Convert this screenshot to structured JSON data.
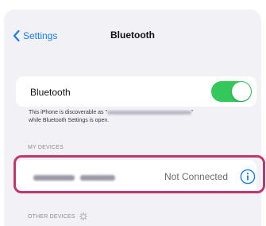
{
  "nav": {
    "back_label": "Settings",
    "title": "Bluetooth"
  },
  "bluetooth": {
    "label": "Bluetooth",
    "enabled": true,
    "desc_prefix": "This iPhone is discoverable as \"",
    "desc_suffix": "\"",
    "desc_line2": "while Bluetooth Settings is open."
  },
  "sections": {
    "my_devices": "MY DEVICES",
    "other_devices": "OTHER DEVICES"
  },
  "device": {
    "status": "Not Connected"
  },
  "colors": {
    "accent": "#1a7cf3",
    "toggle_on": "#34c759",
    "highlight": "#c2366e"
  },
  "icons": {
    "back": "chevron-left-icon",
    "info": "info-circle-icon",
    "spinner": "activity-spinner-icon"
  }
}
